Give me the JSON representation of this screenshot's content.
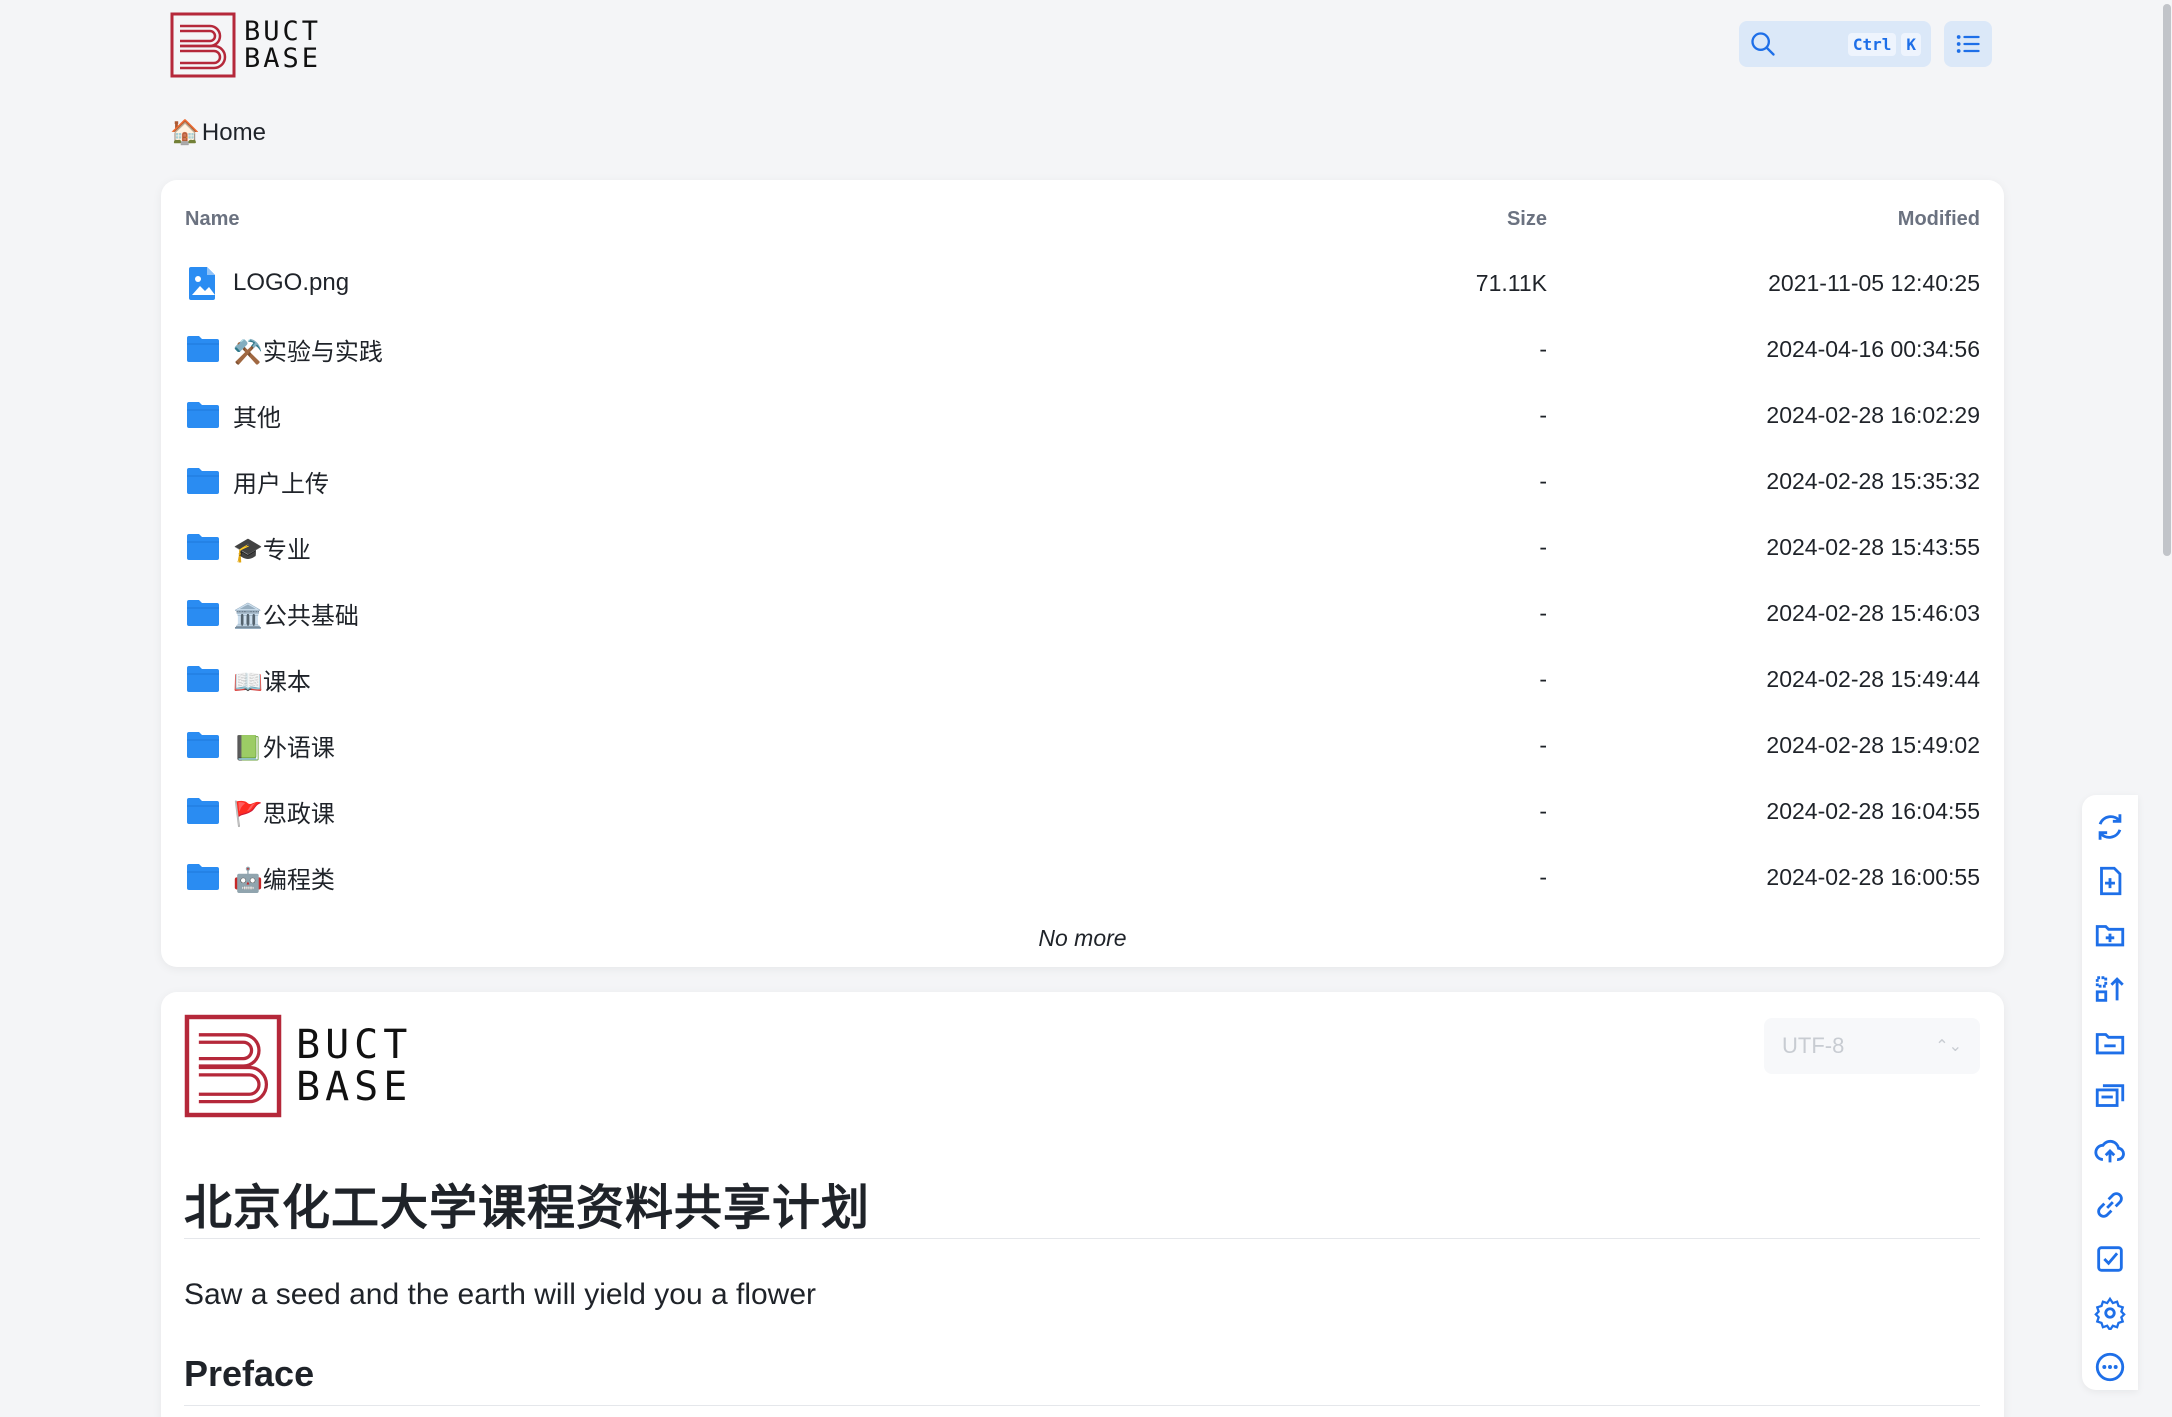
{
  "header": {
    "logo_line1": "BUCT",
    "logo_line2": "BASE",
    "search_key1": "Ctrl",
    "search_key2": "K"
  },
  "breadcrumb": {
    "emoji": "🏠",
    "label": "Home"
  },
  "file_list": {
    "columns": {
      "name": "Name",
      "size": "Size",
      "modified": "Modified"
    },
    "rows": [
      {
        "icon": "image-file-icon",
        "name": "LOGO.png",
        "size": "71.11K",
        "modified": "2021-11-05 12:40:25"
      },
      {
        "icon": "folder-icon",
        "name": "⚒️实验与实践",
        "size": "-",
        "modified": "2024-04-16 00:34:56"
      },
      {
        "icon": "folder-icon",
        "name": "其他",
        "size": "-",
        "modified": "2024-02-28 16:02:29"
      },
      {
        "icon": "folder-icon",
        "name": "用户上传",
        "size": "-",
        "modified": "2024-02-28 15:35:32"
      },
      {
        "icon": "folder-icon",
        "name": "🎓专业",
        "size": "-",
        "modified": "2024-02-28 15:43:55"
      },
      {
        "icon": "folder-icon",
        "name": "🏛️公共基础",
        "size": "-",
        "modified": "2024-02-28 15:46:03"
      },
      {
        "icon": "folder-icon",
        "name": "📖课本",
        "size": "-",
        "modified": "2024-02-28 15:49:44"
      },
      {
        "icon": "folder-icon",
        "name": "📗外语课",
        "size": "-",
        "modified": "2024-02-28 15:49:02"
      },
      {
        "icon": "folder-icon",
        "name": "🚩思政课",
        "size": "-",
        "modified": "2024-02-28 16:04:55"
      },
      {
        "icon": "folder-icon",
        "name": "🤖编程类",
        "size": "-",
        "modified": "2024-02-28 16:00:55"
      }
    ],
    "footer": "No more"
  },
  "readme": {
    "logo_line1": "BUCT",
    "logo_line2": "BASE",
    "encoding": "UTF-8",
    "title": "北京化工大学课程资料共享计划",
    "subtitle": "Saw a seed and the earth will yield you a flower",
    "heading": "Preface"
  },
  "toolbar": [
    "refresh-icon",
    "new-file-icon",
    "new-folder-icon",
    "sort-icon",
    "folder-open-icon",
    "move-icon",
    "upload-cloud-icon",
    "link-icon",
    "checkbox-icon",
    "settings-icon",
    "more-icon"
  ],
  "colors": {
    "accent": "#1e6fe8",
    "logo_red": "#b5283a",
    "folder_blue": "#2a8cf2"
  }
}
